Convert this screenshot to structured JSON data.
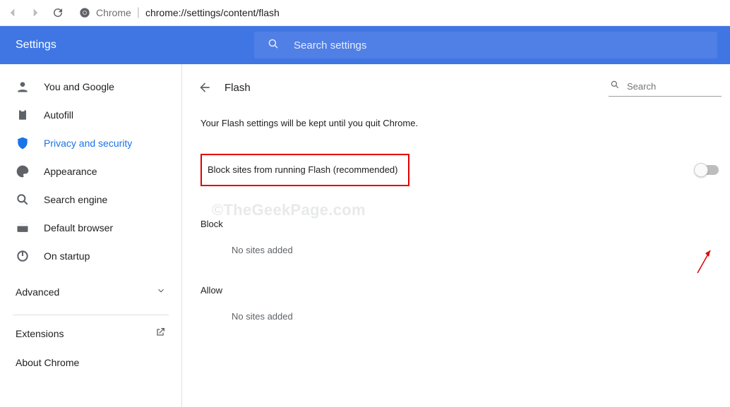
{
  "browser": {
    "host": "Chrome",
    "path": "chrome://settings/content/flash"
  },
  "header": {
    "title": "Settings",
    "search_placeholder": "Search settings"
  },
  "sidebar": {
    "items": [
      {
        "label": "You and Google"
      },
      {
        "label": "Autofill"
      },
      {
        "label": "Privacy and security"
      },
      {
        "label": "Appearance"
      },
      {
        "label": "Search engine"
      },
      {
        "label": "Default browser"
      },
      {
        "label": "On startup"
      }
    ],
    "advanced_label": "Advanced",
    "extensions_label": "Extensions",
    "about_label": "About Chrome"
  },
  "page": {
    "title": "Flash",
    "search_placeholder": "Search",
    "info": "Your Flash settings will be kept until you quit Chrome.",
    "option_label": "Block sites from running Flash (recommended)",
    "block_label": "Block",
    "allow_label": "Allow",
    "no_sites_text": "No sites added"
  },
  "watermark": "©TheGeekPage.com"
}
